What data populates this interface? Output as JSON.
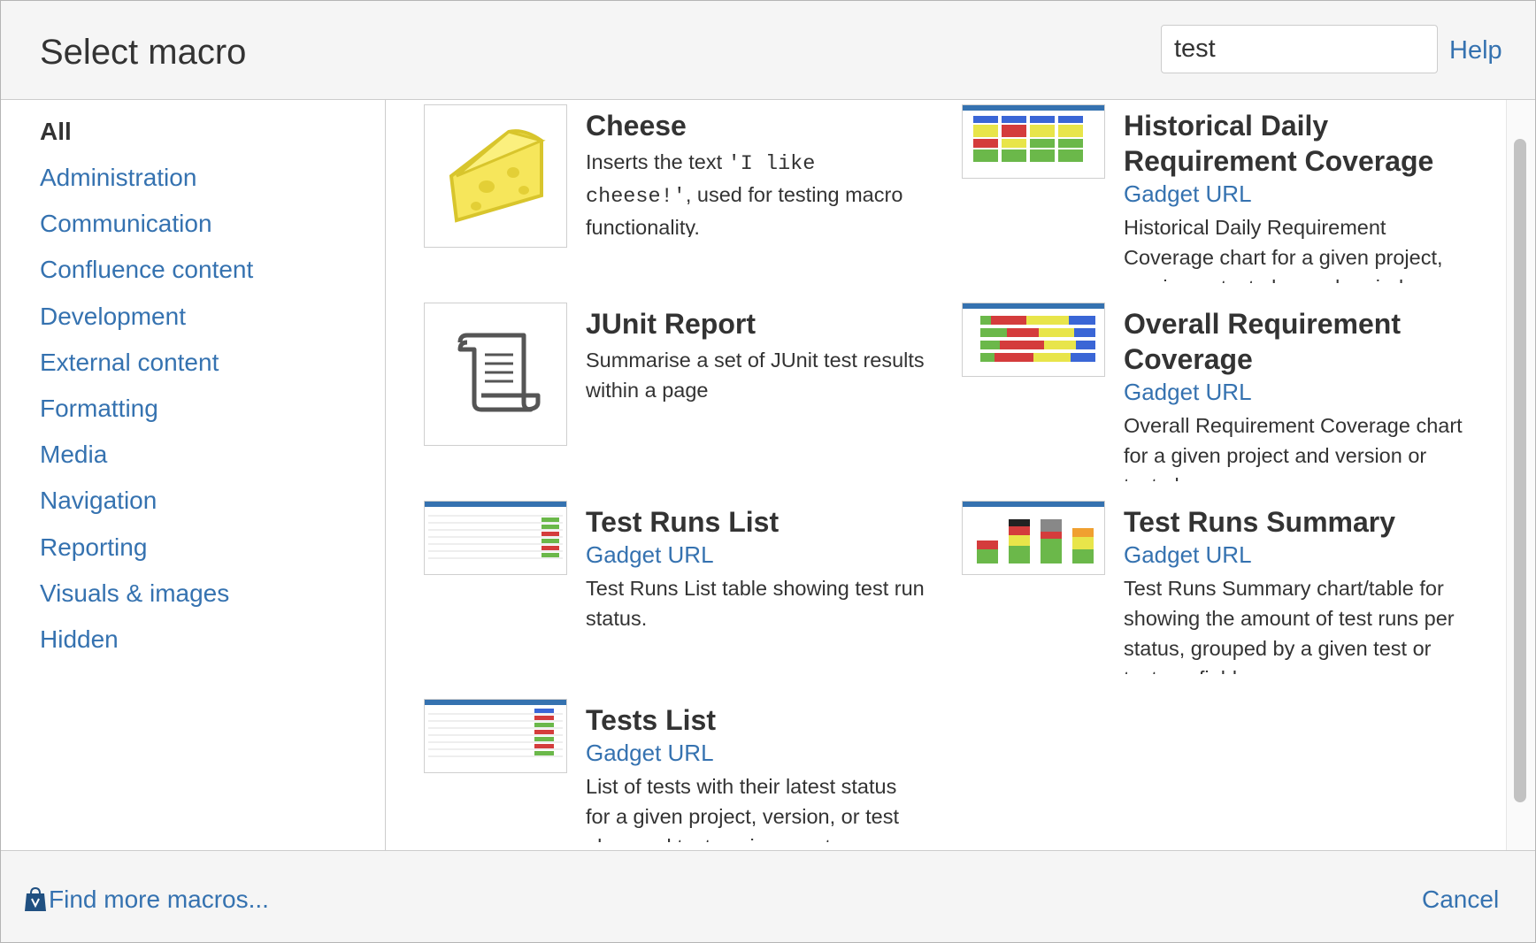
{
  "dialog": {
    "title": "Select macro"
  },
  "search": {
    "value": "test",
    "placeholder": ""
  },
  "help_label": "Help",
  "categories": [
    {
      "label": "All",
      "active": true
    },
    {
      "label": "Administration"
    },
    {
      "label": "Communication"
    },
    {
      "label": "Confluence content"
    },
    {
      "label": "Development"
    },
    {
      "label": "External content"
    },
    {
      "label": "Formatting"
    },
    {
      "label": "Media"
    },
    {
      "label": "Navigation"
    },
    {
      "label": "Reporting"
    },
    {
      "label": "Visuals & images"
    },
    {
      "label": "Hidden"
    }
  ],
  "macros": {
    "cheese": {
      "name": "Cheese",
      "desc_pre": "Inserts the text ",
      "desc_code": "'I like cheese!'",
      "desc_post": ", used for testing macro functionality.",
      "icon": "cheese-icon"
    },
    "historical": {
      "name": "Historical Daily Requirement Coverage",
      "link": "Gadget URL",
      "desc": "Historical Daily Requirement Coverage chart for a given project, version or test plan and period"
    },
    "junit": {
      "name": "JUnit Report",
      "desc": "Summarise a set of JUnit test results within a page",
      "icon": "scroll-icon"
    },
    "overall": {
      "name": "Overall Requirement Coverage",
      "link": "Gadget URL",
      "desc": "Overall Requirement Coverage chart for a given project and version or test plan"
    },
    "runs_list": {
      "name": "Test Runs List",
      "link": "Gadget URL",
      "desc": "Test Runs List table showing test run status."
    },
    "runs_summary": {
      "name": "Test Runs Summary",
      "link": "Gadget URL",
      "desc": "Test Runs Summary chart/table for showing the amount of test runs per status, grouped by a given test or test run field."
    },
    "tests_list": {
      "name": "Tests List",
      "link": "Gadget URL",
      "desc": "List of tests with their latest status for a given project, version, or test plan, and test environment."
    }
  },
  "footer": {
    "find_more": "Find more macros...",
    "cancel": "Cancel"
  },
  "colors": {
    "link": "#3572b0",
    "text": "#333333",
    "header_bg": "#f5f5f5"
  }
}
